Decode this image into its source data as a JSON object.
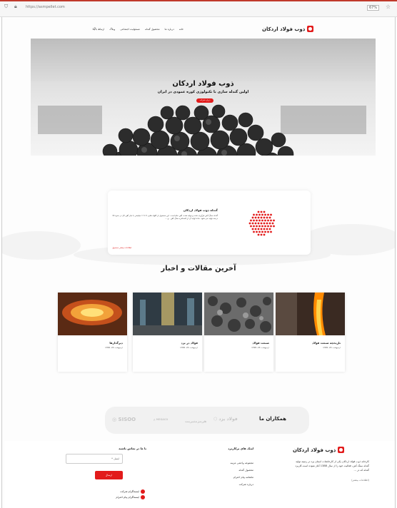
{
  "browser": {
    "url": "https://asmpellet.com",
    "zoom": "67%"
  },
  "header": {
    "logo_text": "ذوب فولاد اردکان",
    "nav": [
      "خانه",
      "درباره ما",
      "محصول گندله",
      "مسئولیت اجتماعی",
      "وبلاگ",
      "ارتباط با ما"
    ]
  },
  "hero": {
    "title": "ذوب فولاد اردکان",
    "subtitle": "اولین گندله سازی با تکنولوژی کوره عمودی در ایران",
    "button_label": "درباره شرکت"
  },
  "intro": {
    "title": "گندله ذوب فولاد اردکان",
    "text": "گندله سنگ آهن فرآوری شده و تولید شده، آهن خام است. این محصول از کلوله هایی ۹ تا ۱۶ میلیمتر با عیار آهن کل در حدود ۶۵ درصد تولید می شود. مادۀ اولیه آن از کنسانتره سنگ آهن . و ...",
    "link": "اطلاعات بیشتر محصول"
  },
  "articles": {
    "title": "آخرین مقالات و اخبار",
    "items": [
      {
        "title": "تاریخچه صنعت فولاد",
        "date": "اردیبهشت 24، 1399"
      },
      {
        "title": "صنعت فولاد",
        "date": "اردیبهشت 24، 1399"
      },
      {
        "title": "فولاد در یزد",
        "date": "اردیبهشت 24، 1399"
      },
      {
        "title": "دیرگدازها",
        "date": "اردیبهشت 24، 1399"
      }
    ]
  },
  "partners": {
    "title": "همکاران ما",
    "logos": [
      "فولاد یزد",
      "هرمزمتیریت",
      "MEGACO",
      "SISOO"
    ]
  },
  "footer": {
    "logo_text": "ذوب فولاد اردکان",
    "about": "کارخانه ذوب فولاد اردکان یکی از کارخانجات استان یزد در زمینه تولید گندله سنگ آهن، فعالیت خود را از سال 1388 آغاز نموده است.کاربرد گندله که در ...",
    "more": "(اطلاعات بیشتر)",
    "links_title": "لینک های پرکاربرد",
    "links": [
      "مجموعه واحمی مزینه",
      "محصول گندله",
      "ماهنامه پیام احترام",
      "درباره شرکت"
    ],
    "contact_title": "با ما در تماس باشید",
    "email_placeholder": "ایمیل *",
    "submit": "ارسال",
    "social": [
      "اینستاگرام شرکت",
      "اینستاگرام پیام احترام"
    ]
  },
  "colors": {
    "accent": "#e21b1b"
  }
}
